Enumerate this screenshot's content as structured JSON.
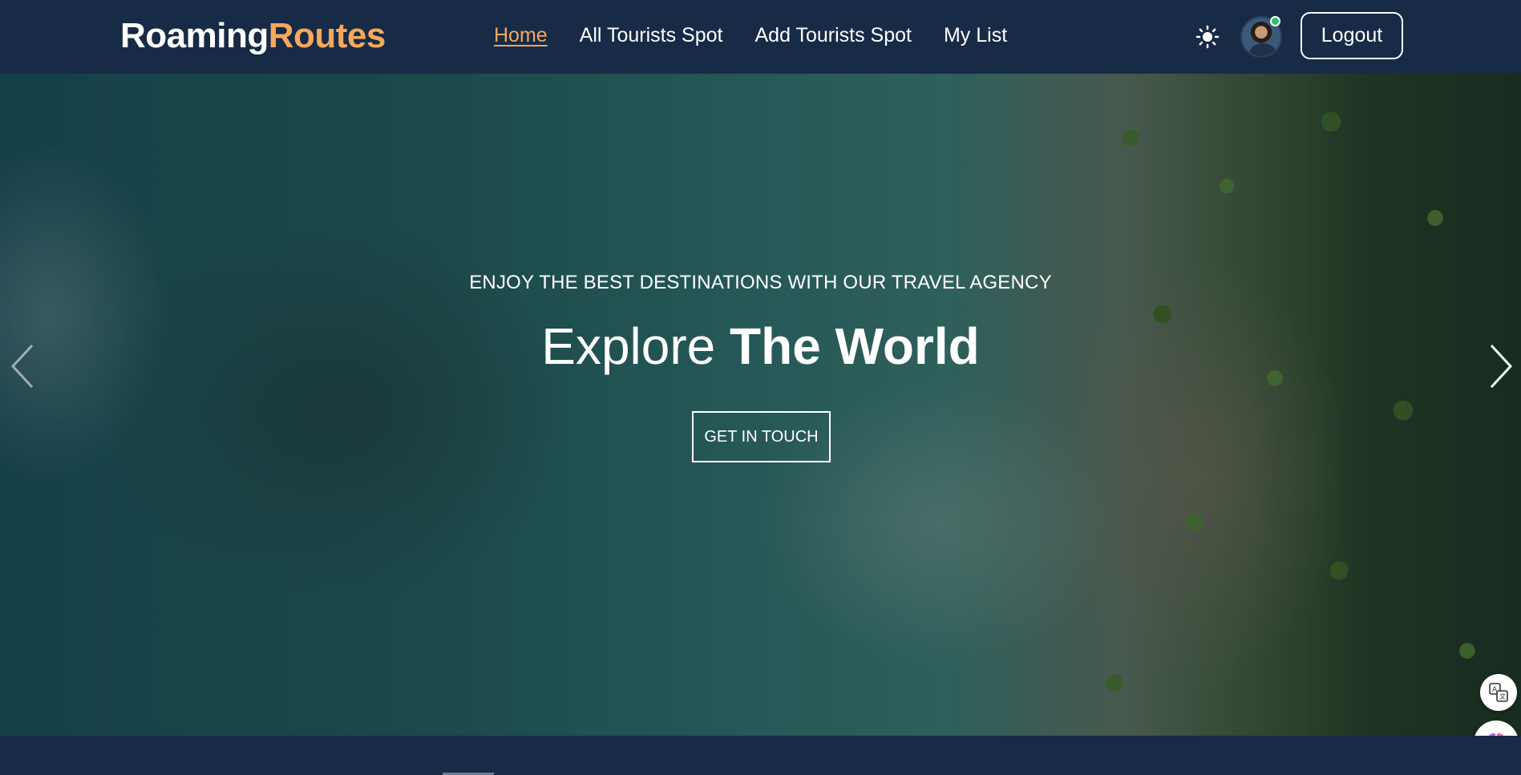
{
  "logo": {
    "part1": "Roaming",
    "part2": "Routes"
  },
  "nav": {
    "items": [
      {
        "label": "Home",
        "active": true
      },
      {
        "label": "All Tourists Spot",
        "active": false
      },
      {
        "label": "Add Tourists Spot",
        "active": false
      },
      {
        "label": "My List",
        "active": false
      }
    ],
    "logout_label": "Logout"
  },
  "hero": {
    "tagline": "ENJOY THE BEST DESTINATIONS WITH OUR TRAVEL AGENCY",
    "headline_light": "Explore",
    "headline_bold": "The World",
    "cta_label": "GET IN TOUCH"
  },
  "icons": {
    "theme": "sun-icon",
    "prev": "chevron-left-icon",
    "next": "chevron-right-icon",
    "translate": "translate-icon",
    "assistant": "brain-icon"
  },
  "colors": {
    "navbar_bg": "#172b47",
    "accent": "#f6a85c",
    "text": "#ffffff",
    "online": "#27c26c"
  }
}
